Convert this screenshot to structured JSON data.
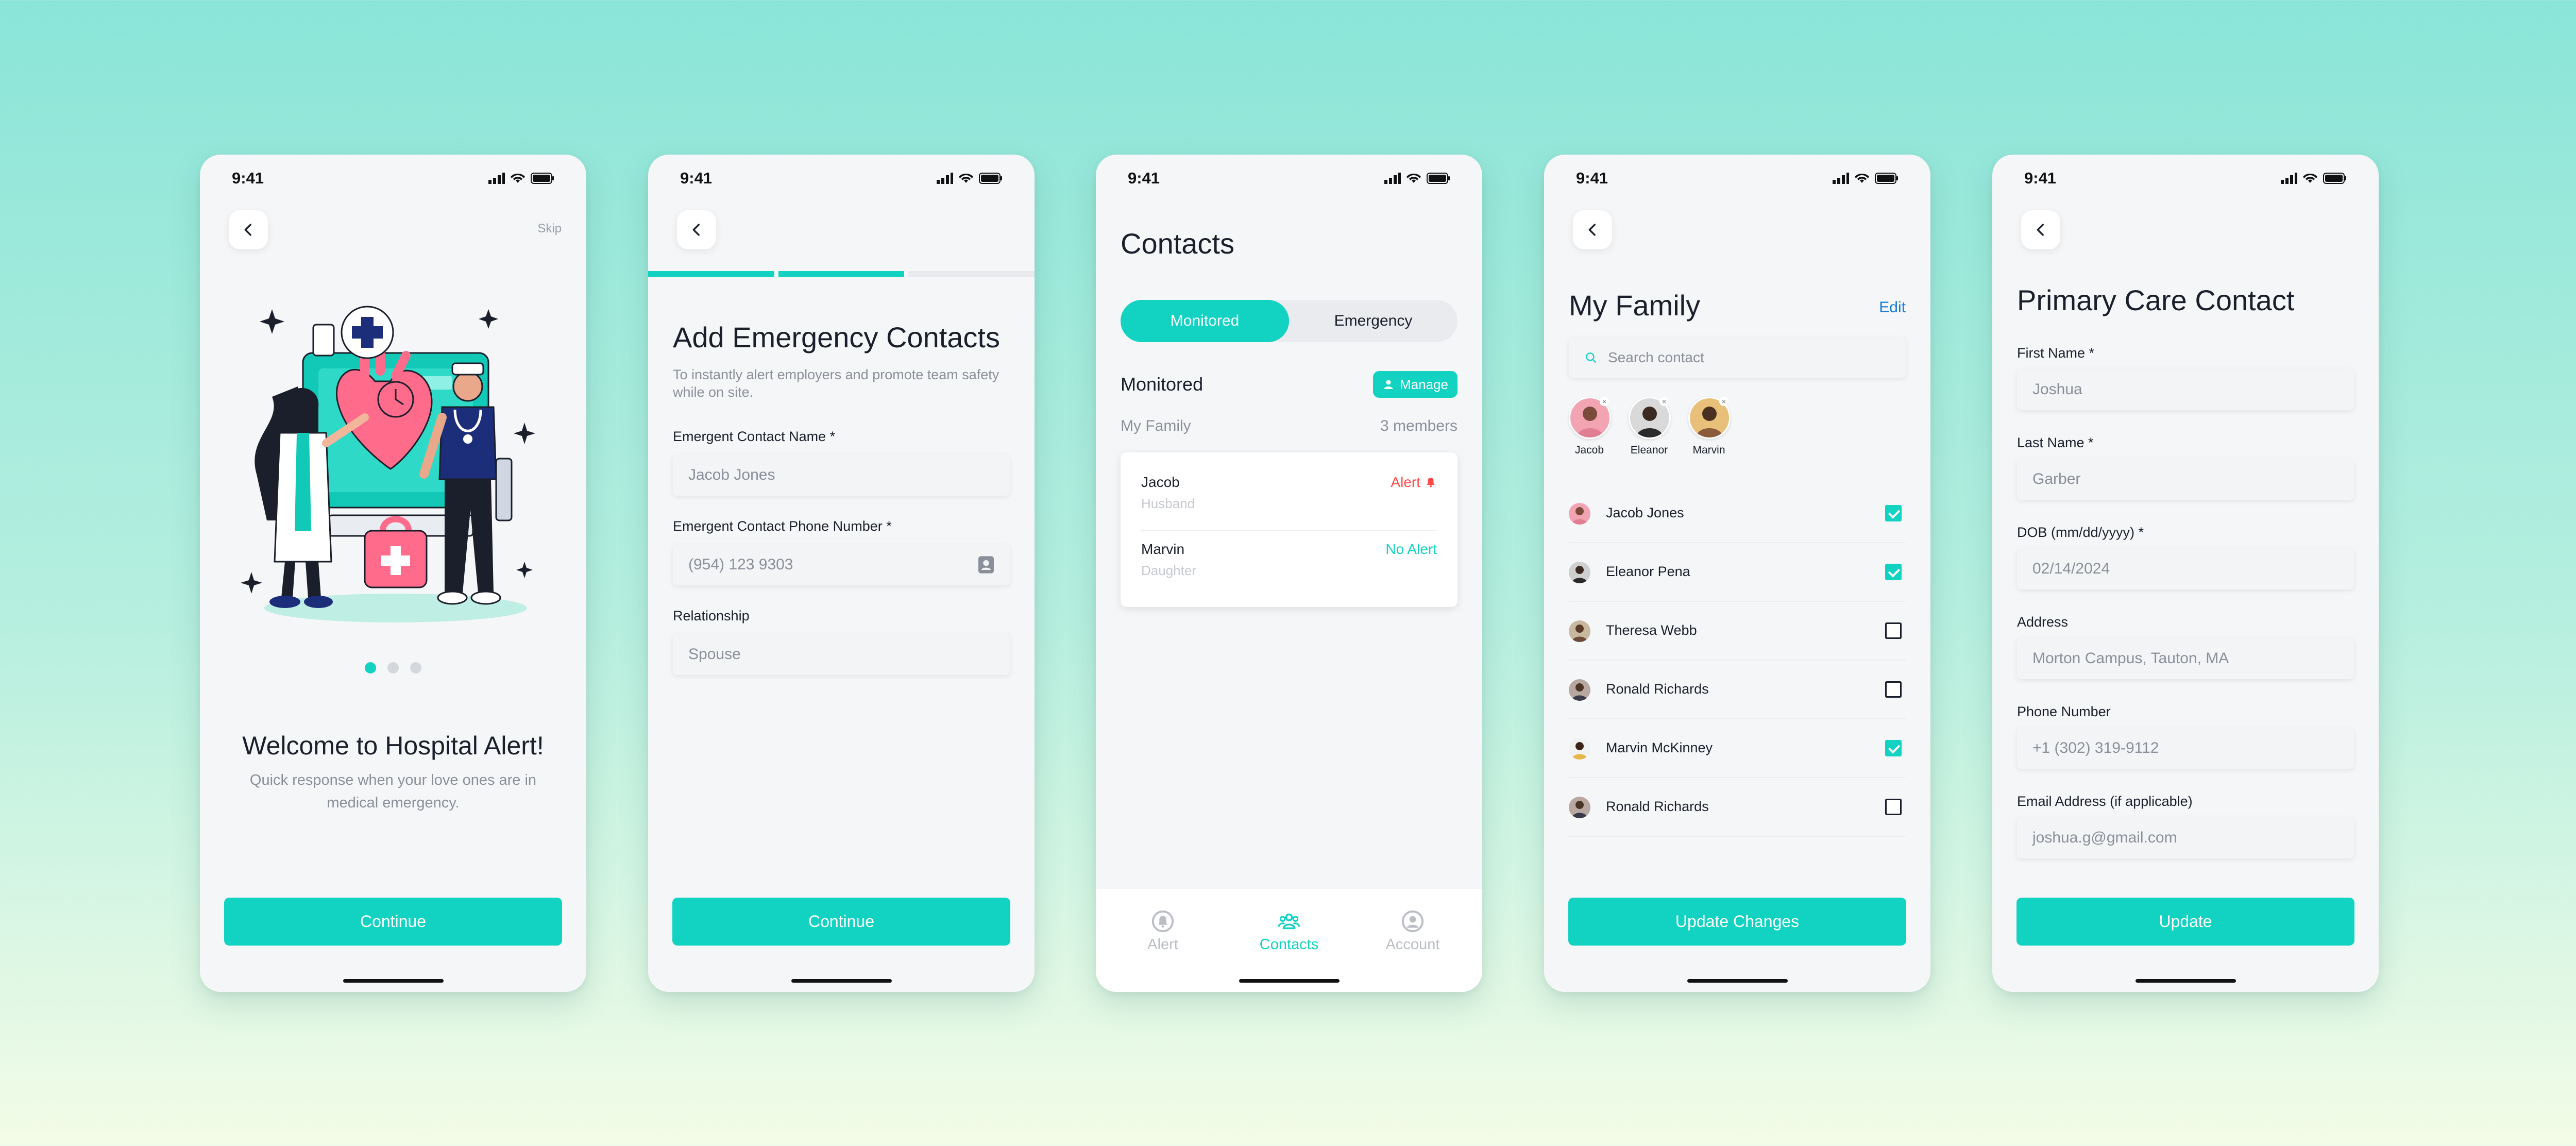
{
  "status_time": "9:41",
  "screen1": {
    "skip": "Skip",
    "title": "Welcome to Hospital Alert!",
    "subtitle": "Quick response when your love ones are in medical emergency.",
    "continue": "Continue"
  },
  "screen2": {
    "title": "Add Emergency Contacts",
    "description": "To instantly alert employers and promote team safety while on site.",
    "name_label": "Emergent Contact Name *",
    "name_placeholder": "Jacob Jones",
    "phone_label": "Emergent Contact Phone Number *",
    "phone_placeholder": "(954) 123 9303",
    "relationship_label": "Relationship",
    "relationship_placeholder": "Spouse",
    "continue": "Continue",
    "progress_steps_total": 3,
    "progress_steps_done": 2
  },
  "screen3": {
    "title": "Contacts",
    "toggle": [
      "Monitored",
      "Emergency"
    ],
    "section": "Monitored",
    "manage": "Manage",
    "group_name": "My Family",
    "group_count": "3 members",
    "contacts": [
      {
        "name": "Jacob",
        "relation": "Husband",
        "status": "Alert",
        "status_color": "#ff4a4a"
      },
      {
        "name": "Marvin",
        "relation": "Daughter",
        "status": "No Alert",
        "status_color": "#12d2c2"
      }
    ],
    "tabs": [
      "Alert",
      "Contacts",
      "Account"
    ]
  },
  "screen4": {
    "title": "My Family",
    "edit": "Edit",
    "search_placeholder": "Search contact",
    "selected": [
      "Jacob",
      "Eleanor",
      "Marvin"
    ],
    "list": [
      {
        "name": "Jacob Jones",
        "checked": true
      },
      {
        "name": "Eleanor Pena",
        "checked": true
      },
      {
        "name": "Theresa Webb",
        "checked": false
      },
      {
        "name": "Ronald Richards",
        "checked": false
      },
      {
        "name": "Marvin McKinney",
        "checked": true
      },
      {
        "name": "Ronald Richards",
        "checked": false
      }
    ],
    "update": "Update Changes"
  },
  "screen5": {
    "title": "Primary Care Contact",
    "fields": [
      {
        "label": "First Name *",
        "value": "Joshua"
      },
      {
        "label": "Last Name *",
        "value": "Garber"
      },
      {
        "label": "DOB (mm/dd/yyyy) *",
        "value": "02/14/2024"
      },
      {
        "label": "Address",
        "value": "Morton Campus, Tauton, MA"
      },
      {
        "label": "Phone Number",
        "value": "+1 (302) 319-9112"
      },
      {
        "label": "Email Address (if applicable)",
        "value": "joshua.g@gmail.com"
      }
    ],
    "update": "Update"
  },
  "colors": {
    "accent": "#12d2c2",
    "alert": "#ff4a4a",
    "link": "#1a7bd6"
  }
}
